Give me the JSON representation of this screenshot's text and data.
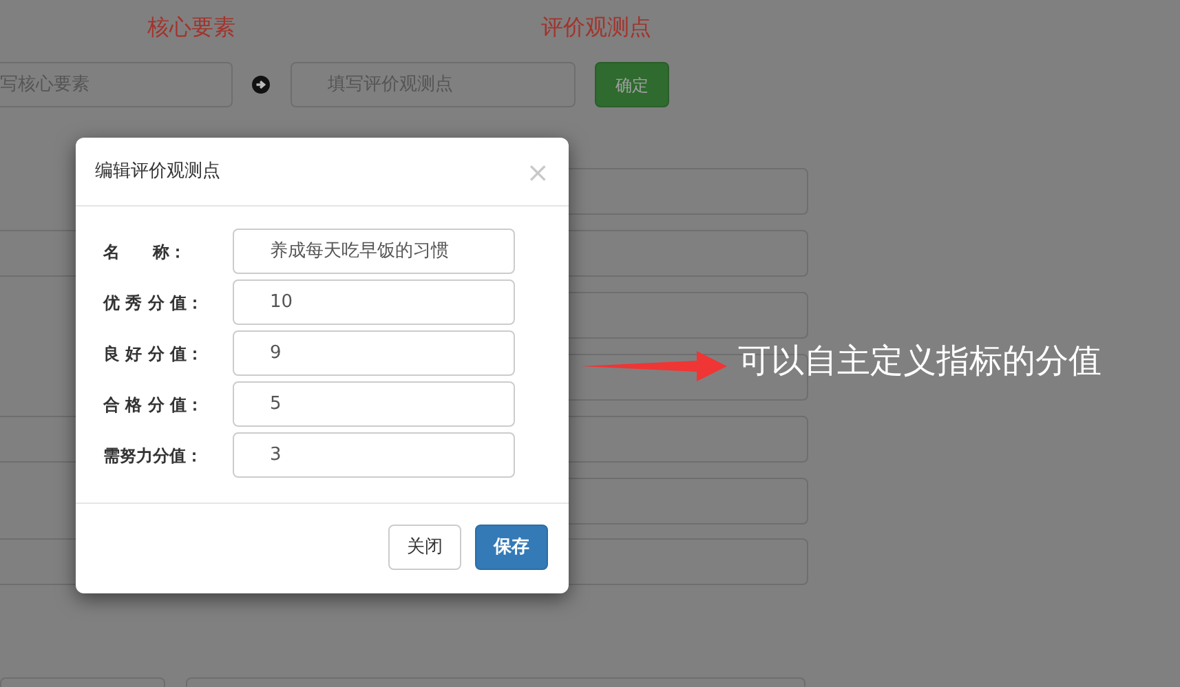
{
  "header": {
    "columns": [
      "核心要素",
      "评价观测点"
    ]
  },
  "entry": {
    "core_placeholder": "写核心要素",
    "point_placeholder": "填写评价观测点",
    "confirm": "确定"
  },
  "modal": {
    "title": "编辑评价观测点",
    "close": "×",
    "fields": [
      {
        "label": "名　　称：",
        "value": "养成每天吃早饭的习惯"
      },
      {
        "label": "优 秀 分 值：",
        "value": "10"
      },
      {
        "label": "良 好 分 值：",
        "value": "9"
      },
      {
        "label": "合 格 分 值：",
        "value": "5"
      },
      {
        "label": "需努力分值：",
        "value": "3"
      }
    ],
    "buttons": [
      {
        "label": "关闭",
        "kind": "default"
      },
      {
        "label": "保存",
        "kind": "primary"
      }
    ]
  },
  "annotation": {
    "text": "可以自主定义指标的分值"
  }
}
